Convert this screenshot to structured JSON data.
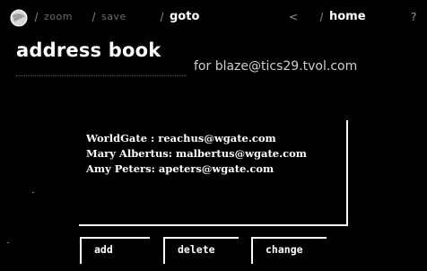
{
  "nav": {
    "items": [
      {
        "label": "zoom",
        "style": "dim"
      },
      {
        "label": "save",
        "style": "dim"
      },
      {
        "label": "goto",
        "style": "bright"
      },
      {
        "label": "home",
        "style": "bright"
      }
    ],
    "glyph_back": "<",
    "glyph_help": "?"
  },
  "header": {
    "title": "address book",
    "account": "for blaze@tics29.tvol.com"
  },
  "contacts": [
    {
      "name": "WorldGate",
      "separator": " : ",
      "email": "reachus@wgate.com"
    },
    {
      "name": "Mary Albertus",
      "separator": ": ",
      "email": "malbertus@wgate.com"
    },
    {
      "name": "Amy Peters",
      "separator": ": ",
      "email": "apeters@wgate.com"
    }
  ],
  "actions": {
    "add": "add",
    "delete": "delete",
    "change": "change"
  },
  "colors": {
    "background": "#000000",
    "text": "#ffffff",
    "dim_text": "#6c6c6c"
  }
}
